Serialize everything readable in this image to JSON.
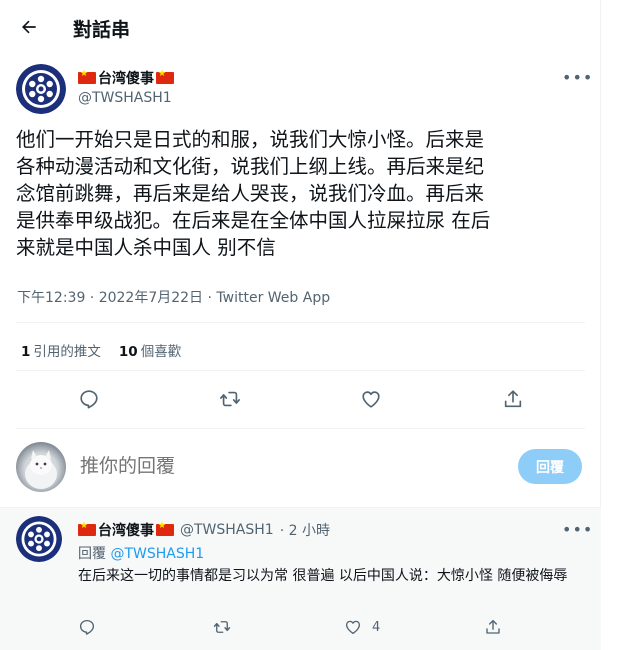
{
  "header": {
    "title": "對話串"
  },
  "main_tweet": {
    "display_name": "台湾傻事",
    "handle": "@TWSHASH1",
    "text": "他们一开始只是日式的和服，说我们大惊小怪。后来是\n各种动漫活动和文化街，说我们上纲上线。再后来是纪\n念馆前跳舞，再后来是给人哭丧，说我们冷血。再后来\n是供奉甲级战犯。在后来是在全体中国人拉屎拉尿  在后\n来就是中国人杀中国人 别不信",
    "meta": "下午12:39 · 2022年7月22日 · Twitter Web App",
    "retweet_count": "1",
    "retweet_label": "引用的推文",
    "like_count": "10",
    "like_label": "個喜歡"
  },
  "composer": {
    "placeholder": "推你的回覆",
    "button_label": "回覆"
  },
  "reply_tweet": {
    "display_name": "台湾傻事",
    "handle": "@TWSHASH1",
    "time": "· 2 小時",
    "replying_prefix": "回覆",
    "replying_to": "@TWSHASH1",
    "text": "在后来这一切的事情都是习以为常  很普遍    以后中国人说：大惊小怪  随便被侮辱",
    "like_count": "4"
  },
  "colors": {
    "accent": "#1d9bf0",
    "reply_button": "#8ecdf8",
    "flag": "#de2910",
    "logo": "#1b2f7a"
  },
  "icons": [
    "back-arrow-icon",
    "more-icon",
    "reply-icon",
    "retweet-icon",
    "like-icon",
    "share-icon",
    "flag-icon"
  ]
}
